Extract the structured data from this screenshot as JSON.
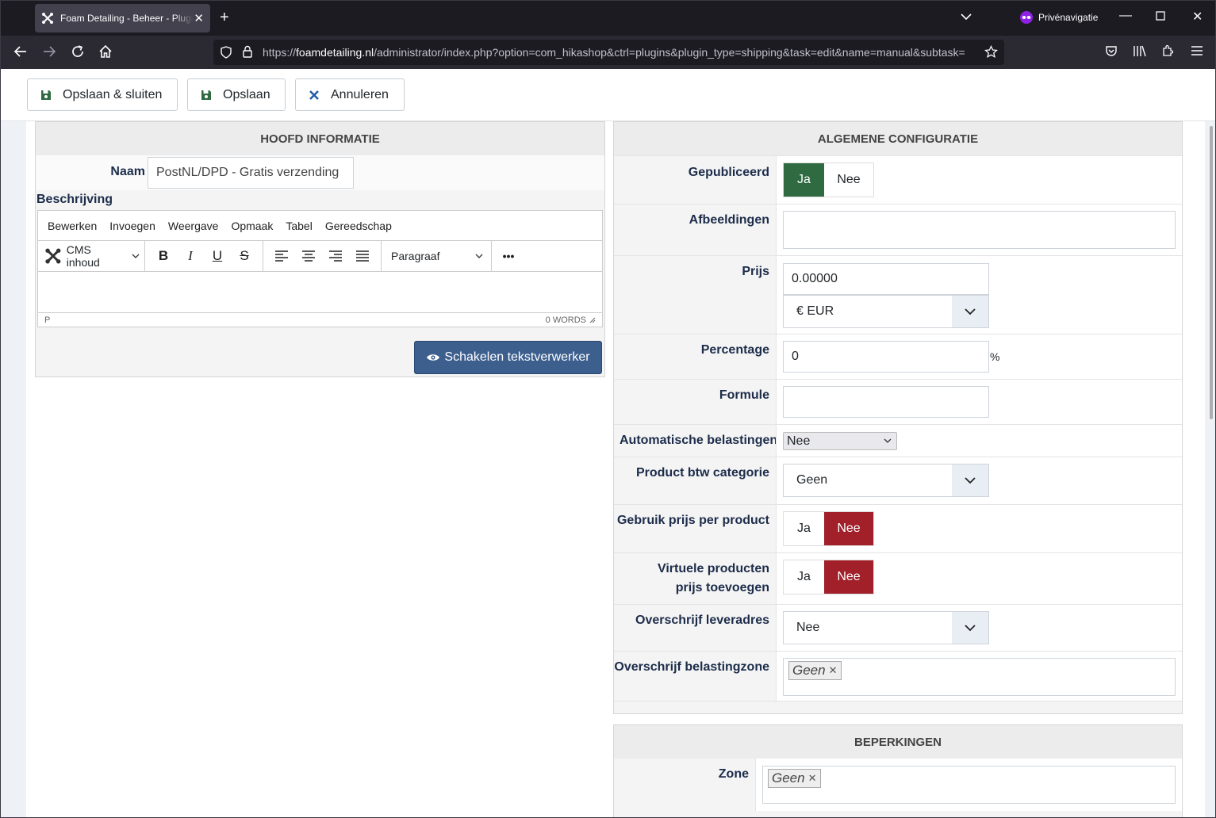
{
  "browser": {
    "tab_title": "Foam Detailing - Beheer - Plugins",
    "private_label": "Privénavigatie",
    "url_prefix": "https://",
    "url_domain": "foamdetailing.nl",
    "url_path": "/administrator/index.php?option=com_hikashop&ctrl=plugins&plugin_type=shipping&task=edit&name=manual&subtask="
  },
  "toolbar": {
    "save_close_label": "Opslaan & sluiten",
    "save_label": "Opslaan",
    "cancel_label": "Annuleren"
  },
  "main_info": {
    "heading": "HOOFD INFORMATIE",
    "name_label": "Naam",
    "name_value": "PostNL/DPD - Gratis verzending",
    "description_label": "Beschrijving",
    "editor_menu": [
      "Bewerken",
      "Invoegen",
      "Weergave",
      "Opmaak",
      "Tabel",
      "Gereedschap"
    ],
    "cms_content_label": "CMS inhoud",
    "paragraph_label": "Paragraaf",
    "more_label": "•••",
    "status_path": "P",
    "word_count": "0 WORDS",
    "toggle_editor_label": "Schakelen tekstverwerker"
  },
  "general_config": {
    "heading": "ALGEMENE CONFIGURATIE",
    "published_label": "Gepubliceerd",
    "yes": "Ja",
    "no": "Nee",
    "images_label": "Afbeeldingen",
    "price_label": "Prijs",
    "price_value": "0.00000",
    "currency_value": "€ EUR",
    "percentage_label": "Percentage",
    "percentage_value": "0",
    "percent_sign": "%",
    "formula_label": "Formule",
    "auto_tax_label": "Automatische belastingen",
    "auto_tax_value": "Nee",
    "tax_category_label": "Product btw categorie",
    "tax_category_value": "Geen",
    "per_product_label": "Gebruik prijs per product",
    "virtual_label_1": "Virtuele producten",
    "virtual_label_2": "prijs toevoegen",
    "override_address_label": "Overschrijf leveradres",
    "override_address_value": "Nee",
    "override_zone_label": "Overschrijf belastingzone",
    "override_zone_tag": "Geen"
  },
  "restrictions": {
    "heading": "BEPERKINGEN",
    "zone_label": "Zone",
    "zone_tag": "Geen"
  },
  "colors": {
    "active_yes": "#2f6a41",
    "active_no": "#a1202a",
    "primary_button": "#3d5f8e",
    "label_text": "#1c2c4a"
  }
}
